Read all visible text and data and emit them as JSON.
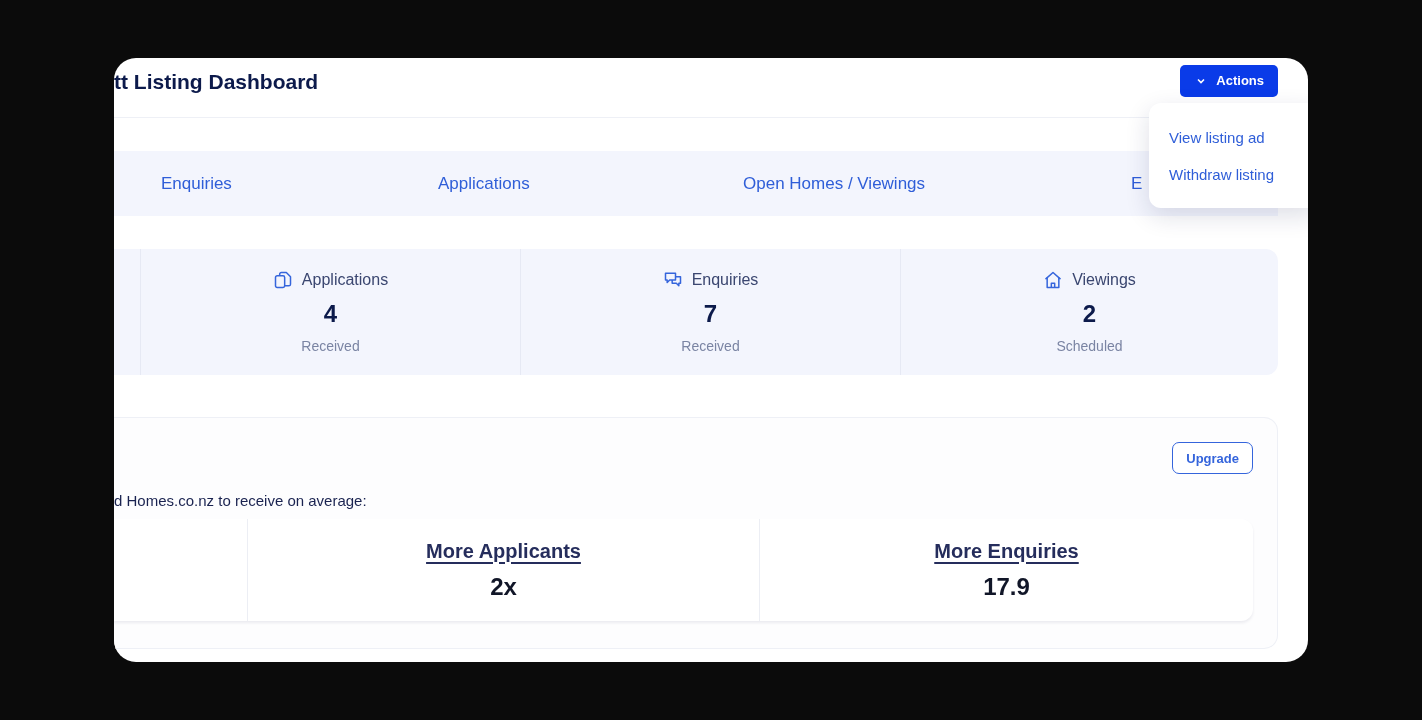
{
  "header": {
    "title": "tt Listing Dashboard",
    "actions_button": "Actions"
  },
  "actions_menu": {
    "items": [
      "View listing ad",
      "Withdraw listing"
    ]
  },
  "tabs": [
    {
      "label": "Enquiries",
      "selected": false
    },
    {
      "label": "Applications",
      "selected": false
    },
    {
      "label": "Open Homes / Viewings",
      "selected": false
    },
    {
      "label": "E",
      "selected": false
    }
  ],
  "stats": [
    {
      "kind": "cut"
    },
    {
      "kind": "applications",
      "label": "Applications",
      "value": "4",
      "caption": "Received"
    },
    {
      "kind": "enquiries",
      "label": "Enquiries",
      "value": "7",
      "caption": "Received"
    },
    {
      "kind": "viewings",
      "label": "Viewings",
      "value": "2",
      "caption": "Scheduled"
    }
  ],
  "upgrade": {
    "button": "Upgrade",
    "text": "d Homes.co.nz to receive on average:",
    "metrics": [
      {
        "label": "More Applicants",
        "value": "2x"
      },
      {
        "label": "More Enquiries",
        "value": "17.9"
      }
    ]
  }
}
